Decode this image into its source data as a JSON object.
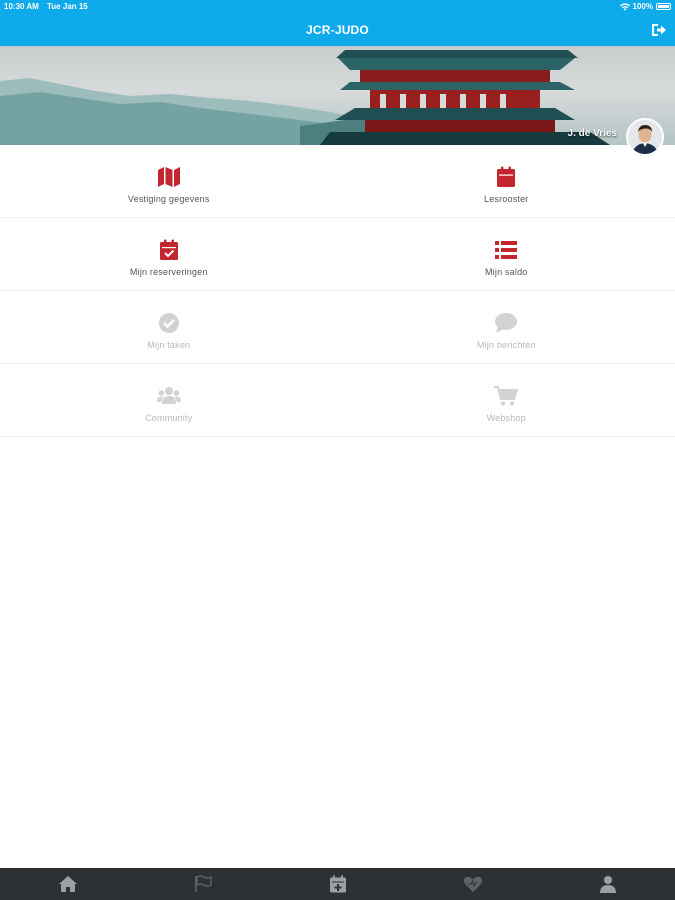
{
  "status_bar": {
    "time": "10:30 AM",
    "date": "Tue Jan 15",
    "battery": "100%"
  },
  "nav": {
    "title": "JCR-JUDO",
    "logout_icon": "sign-out-icon"
  },
  "banner": {
    "user_name": "J. de Vries"
  },
  "colors": {
    "primary": "#0eaaea",
    "icon_active": "#c1272d",
    "icon_disabled": "#d2d2d2",
    "tab_bar": "#2d3133",
    "tab_icon": "#9aa0a3"
  },
  "menu": {
    "rows": [
      [
        {
          "label": "Vestiging gegevens",
          "icon": "map-icon",
          "enabled": true
        },
        {
          "label": "Lesrooster",
          "icon": "calendar-icon",
          "enabled": true
        }
      ],
      [
        {
          "label": "Mijn reserveringen",
          "icon": "calendar-check-icon",
          "enabled": true
        },
        {
          "label": "Mijn saldo",
          "icon": "list-icon",
          "enabled": true
        }
      ],
      [
        {
          "label": "Mijn taken",
          "icon": "check-circle-icon",
          "enabled": false
        },
        {
          "label": "Mijn berichten",
          "icon": "comment-icon",
          "enabled": false
        }
      ],
      [
        {
          "label": "Community",
          "icon": "users-icon",
          "enabled": false
        },
        {
          "label": "Webshop",
          "icon": "cart-icon",
          "enabled": false
        }
      ]
    ]
  },
  "tabs": [
    "home-icon",
    "flag-icon",
    "calendar-plus-icon",
    "heart-icon",
    "user-icon"
  ]
}
